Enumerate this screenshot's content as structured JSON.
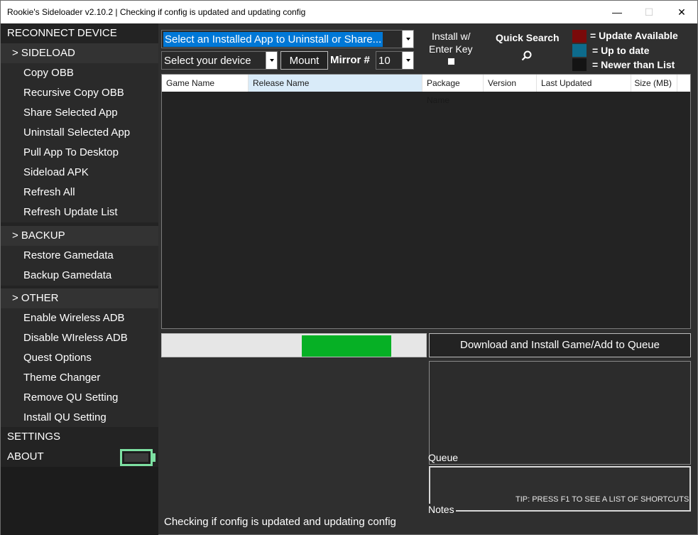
{
  "window": {
    "title": "Rookie's Sideloader v2.10.2 | Checking if config is updated and updating config",
    "minimize_glyph": "—",
    "maximize_glyph": "☐",
    "close_glyph": "✕"
  },
  "sidebar": {
    "reconnect": "RECONNECT DEVICE",
    "sideload_header": "> SIDELOAD",
    "sideload_items": [
      "Copy OBB",
      "Recursive Copy OBB",
      "Share Selected App",
      "Uninstall Selected App",
      "Pull App To Desktop",
      "Sideload APK",
      "Refresh All",
      "Refresh Update List"
    ],
    "backup_header": "> BACKUP",
    "backup_items": [
      "Restore Gamedata",
      "Backup Gamedata"
    ],
    "other_header": "> OTHER",
    "other_items": [
      "Enable Wireless ADB",
      "Disable WIreless ADB",
      "Quest Options",
      "Theme Changer",
      "Remove QU Setting",
      "Install QU Setting"
    ],
    "settings": "SETTINGS",
    "about": "ABOUT"
  },
  "controls": {
    "app_select": "Select an Installed App to Uninstall or Share...",
    "device_select": "Select your device",
    "mount_button": "Mount",
    "mirror_label": "Mirror #",
    "mirror_value": "10",
    "install_enter_key_line1": "Install w/",
    "install_enter_key_line2": "Enter Key",
    "quick_search": "Quick Search",
    "search_icon": "search-icon"
  },
  "legend": {
    "update_available": "= Update Available",
    "up_to_date": "= Up to date",
    "newer_than_list": "= Newer than List",
    "colors": {
      "update_available": "#7a0a0a",
      "up_to_date": "#0d6b8c",
      "newer_than_list": "#141414"
    }
  },
  "list": {
    "columns": [
      "Game Name",
      "Release Name",
      "Package Name",
      "Version",
      "Last Updated",
      "Size (MB)"
    ]
  },
  "progress": {
    "start": 0.53,
    "end": 0.87
  },
  "download_button": "Download and Install Game/Add to Queue",
  "queue_label": "Queue",
  "notes_label": "Notes",
  "tip": "TIP: PRESS F1 TO SEE A LIST OF SHORTCUTS",
  "status": "Checking if config is updated and updating config"
}
